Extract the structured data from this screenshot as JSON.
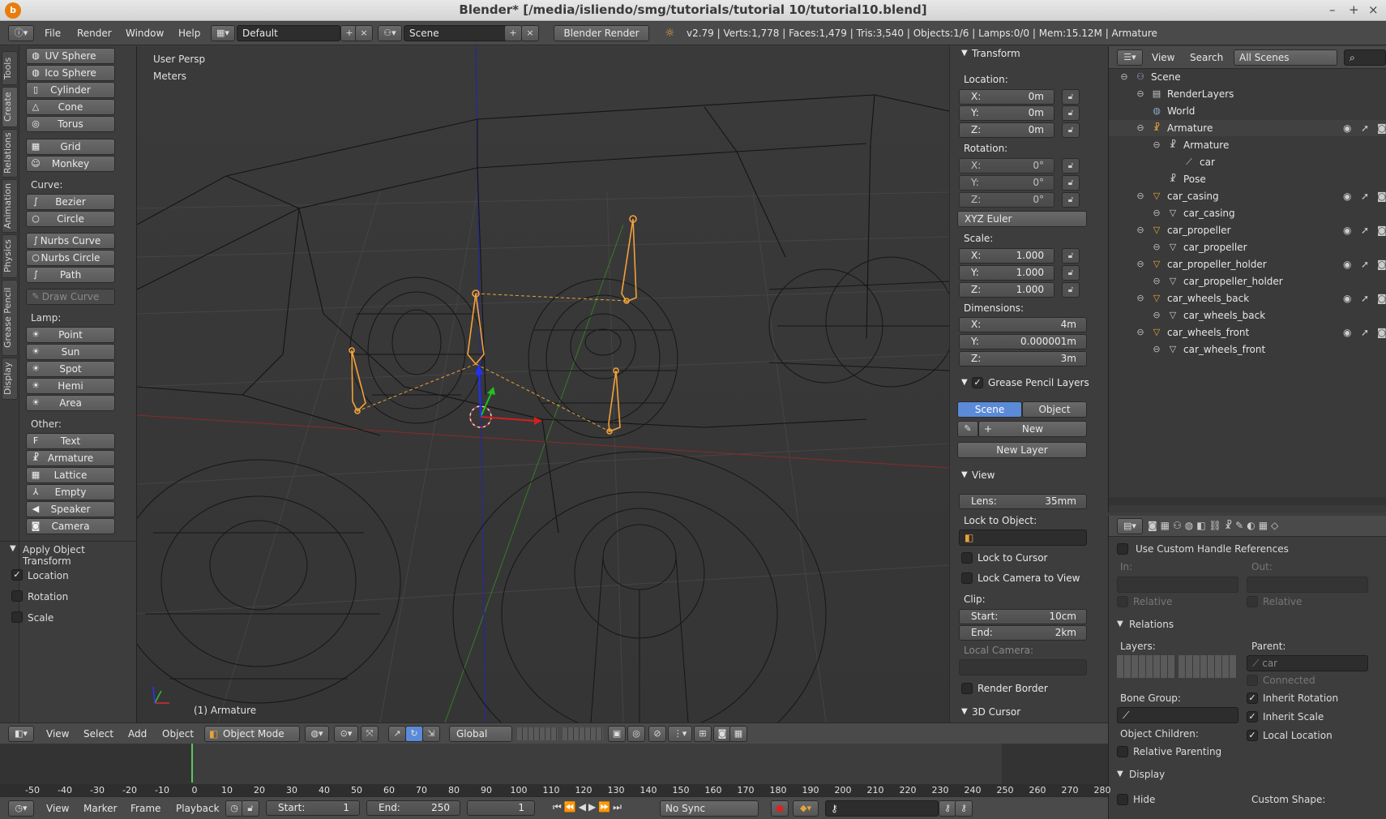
{
  "window": {
    "title": "Blender* [/media/isliendo/smg/tutorials/tutorial 10/tutorial10.blend]",
    "logo": "blender-logo-icon"
  },
  "menu": {
    "file": "File",
    "render": "Render",
    "window": "Window",
    "help": "Help"
  },
  "layout": {
    "screen": "Default",
    "scene": "Scene",
    "engine": "Blender Render"
  },
  "stats": "v2.79 | Verts:1,778 | Faces:1,479 | Tris:3,540 | Objects:1/6 | Lamps:0/0 | Mem:15.12M | Armature",
  "left_tabs": [
    "Tools",
    "Create",
    "Relations",
    "Animation",
    "Physics",
    "Grease Pencil",
    "Display"
  ],
  "create": {
    "mesh": [
      "UV Sphere",
      "Ico Sphere",
      "Cylinder",
      "Cone",
      "Torus",
      "Grid",
      "Monkey"
    ],
    "curve_label": "Curve:",
    "curve": [
      "Bezier",
      "Circle",
      "Nurbs Curve",
      "Nurbs Circle",
      "Path"
    ],
    "draw_curve": "Draw Curve",
    "lamp_label": "Lamp:",
    "lamp": [
      "Point",
      "Sun",
      "Spot",
      "Hemi",
      "Area"
    ],
    "other_label": "Other:",
    "other": [
      "Text",
      "Armature",
      "Lattice",
      "Empty",
      "Speaker",
      "Camera"
    ]
  },
  "apply": {
    "title": "Apply Object Transform",
    "location": "Location",
    "rotation": "Rotation",
    "scale": "Scale"
  },
  "viewport": {
    "persp": "User Persp",
    "units": "Meters",
    "active": "(1) Armature"
  },
  "transform": {
    "title": "Transform",
    "location_label": "Location:",
    "location": [
      {
        "axis": "X:",
        "value": "0m"
      },
      {
        "axis": "Y:",
        "value": "0m"
      },
      {
        "axis": "Z:",
        "value": "0m"
      }
    ],
    "rotation_label": "Rotation:",
    "rotation": [
      {
        "axis": "X:",
        "value": "0°"
      },
      {
        "axis": "Y:",
        "value": "0°"
      },
      {
        "axis": "Z:",
        "value": "0°"
      }
    ],
    "rotation_mode": "XYZ Euler",
    "scale_label": "Scale:",
    "scale": [
      {
        "axis": "X:",
        "value": "1.000"
      },
      {
        "axis": "Y:",
        "value": "1.000"
      },
      {
        "axis": "Z:",
        "value": "1.000"
      }
    ],
    "dimensions_label": "Dimensions:",
    "dimensions": [
      {
        "axis": "X:",
        "value": "4m"
      },
      {
        "axis": "Y:",
        "value": "0.000001m"
      },
      {
        "axis": "Z:",
        "value": "3m"
      }
    ]
  },
  "grease": {
    "title": "Grease Pencil Layers",
    "scene_tab": "Scene",
    "object_tab": "Object",
    "new": "New",
    "new_layer": "New Layer"
  },
  "view": {
    "title": "View",
    "lens_label": "Lens:",
    "lens": "35mm",
    "lock_object": "Lock to Object:",
    "lock_cursor": "Lock to Cursor",
    "lock_camera": "Lock Camera to View",
    "clip_label": "Clip:",
    "start_label": "Start:",
    "start": "10cm",
    "end_label": "End:",
    "end": "2km",
    "local_camera": "Local Camera:",
    "render_border": "Render Border"
  },
  "cursor_panel": "3D Cursor",
  "outliner": {
    "view": "View",
    "search": "Search",
    "filter": "All Scenes",
    "rows": [
      {
        "label": "Scene",
        "icon": "scene-icon",
        "indent": 0
      },
      {
        "label": "RenderLayers",
        "icon": "renderlayers-icon",
        "indent": 1
      },
      {
        "label": "World",
        "icon": "world-icon",
        "indent": 1
      },
      {
        "label": "Armature",
        "icon": "armature-icon",
        "indent": 1
      },
      {
        "label": "Armature",
        "icon": "armature-data-icon",
        "indent": 2
      },
      {
        "label": "car",
        "icon": "bone-icon",
        "indent": 3
      },
      {
        "label": "Pose",
        "icon": "pose-icon",
        "indent": 2
      },
      {
        "label": "car_casing",
        "icon": "mesh-object-icon",
        "indent": 1
      },
      {
        "label": "car_casing",
        "icon": "mesh-data-icon",
        "indent": 2
      },
      {
        "label": "car_propeller",
        "icon": "mesh-object-icon",
        "indent": 1
      },
      {
        "label": "car_propeller",
        "icon": "mesh-data-icon",
        "indent": 2
      },
      {
        "label": "car_propeller_holder",
        "icon": "mesh-object-icon",
        "indent": 1
      },
      {
        "label": "car_propeller_holder",
        "icon": "mesh-data-icon",
        "indent": 2
      },
      {
        "label": "car_wheels_back",
        "icon": "mesh-object-icon",
        "indent": 1
      },
      {
        "label": "car_wheels_back",
        "icon": "mesh-data-icon",
        "indent": 2
      },
      {
        "label": "car_wheels_front",
        "icon": "mesh-object-icon",
        "indent": 1
      },
      {
        "label": "car_wheels_front",
        "icon": "mesh-data-icon",
        "indent": 2
      }
    ]
  },
  "bone_props": {
    "custom_handle": "Use Custom Handle References",
    "in": "In:",
    "out": "Out:",
    "relative": "Relative",
    "relations": "Relations",
    "layers": "Layers:",
    "parent": "Parent:",
    "parent_value": "car",
    "connected": "Connected",
    "bone_group": "Bone Group:",
    "inherit_rotation": "Inherit Rotation",
    "inherit_scale": "Inherit Scale",
    "object_children": "Object Children:",
    "local_location": "Local Location",
    "relative_parenting": "Relative Parenting",
    "display": "Display",
    "hide": "Hide",
    "custom_shape": "Custom Shape:"
  },
  "vheader": {
    "view": "View",
    "select": "Select",
    "add": "Add",
    "object": "Object",
    "mode": "Object Mode",
    "orientation": "Global"
  },
  "timeline": {
    "ticks": [
      "-50",
      "-40",
      "-30",
      "-20",
      "-10",
      "0",
      "10",
      "20",
      "30",
      "40",
      "50",
      "60",
      "70",
      "80",
      "90",
      "100",
      "110",
      "120",
      "130",
      "140",
      "150",
      "160",
      "170",
      "180",
      "190",
      "200",
      "210",
      "220",
      "230",
      "240",
      "250",
      "260",
      "270",
      "280"
    ],
    "current": "1"
  },
  "tlheader": {
    "view": "View",
    "marker": "Marker",
    "frame": "Frame",
    "playback": "Playback",
    "start_label": "Start:",
    "start": "1",
    "end_label": "End:",
    "end": "250",
    "current": "1",
    "sync": "No Sync"
  }
}
